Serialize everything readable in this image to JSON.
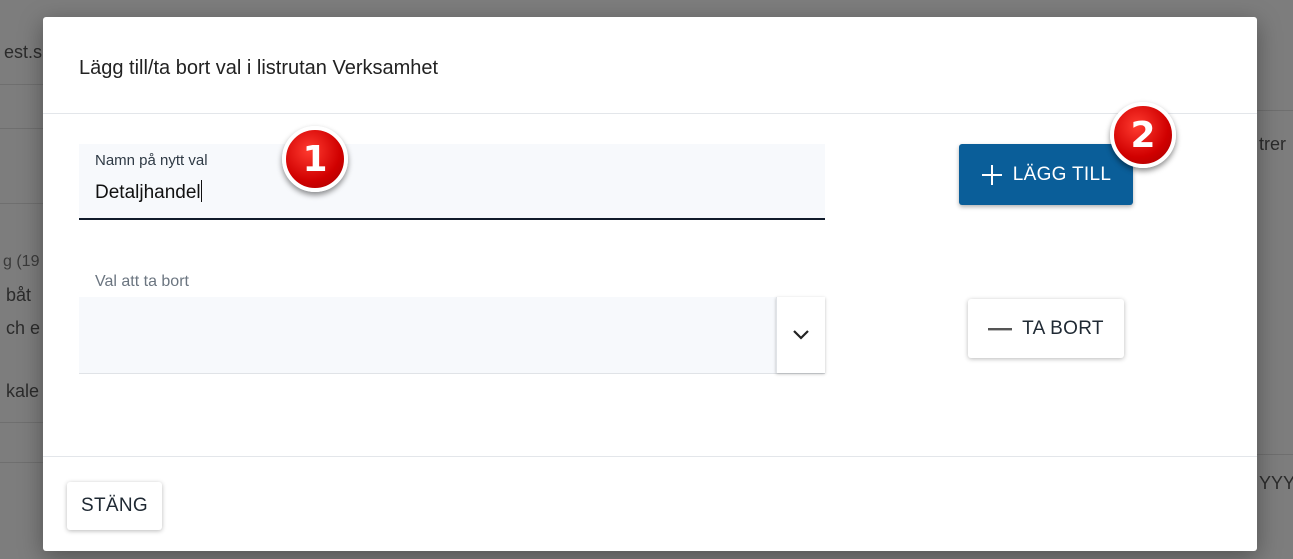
{
  "background": {
    "fragments": [
      "est.s",
      "trer",
      "g (19",
      "båt",
      "ch e",
      "kale",
      "YYYY"
    ]
  },
  "dialog": {
    "title": "Lägg till/ta bort val i listrutan Verksamhet",
    "new_option": {
      "label": "Namn på nytt val",
      "value": "Detaljhandel"
    },
    "remove_select": {
      "label": "Val att ta bort",
      "value": "",
      "toggle_icon": "chevron-down-icon"
    },
    "add_button": {
      "icon": "plus-icon",
      "label": "LÄGG TILL"
    },
    "remove_button": {
      "icon": "minus-icon",
      "label": "TA BORT"
    },
    "close_button": {
      "label": "STÄNG"
    }
  },
  "annotations": [
    {
      "number": "1",
      "color": "#d00000"
    },
    {
      "number": "2",
      "color": "#d00000"
    }
  ],
  "colors": {
    "primary": "#0a5e99",
    "overlay": "#7d7d7d",
    "marker": "#d00000"
  }
}
